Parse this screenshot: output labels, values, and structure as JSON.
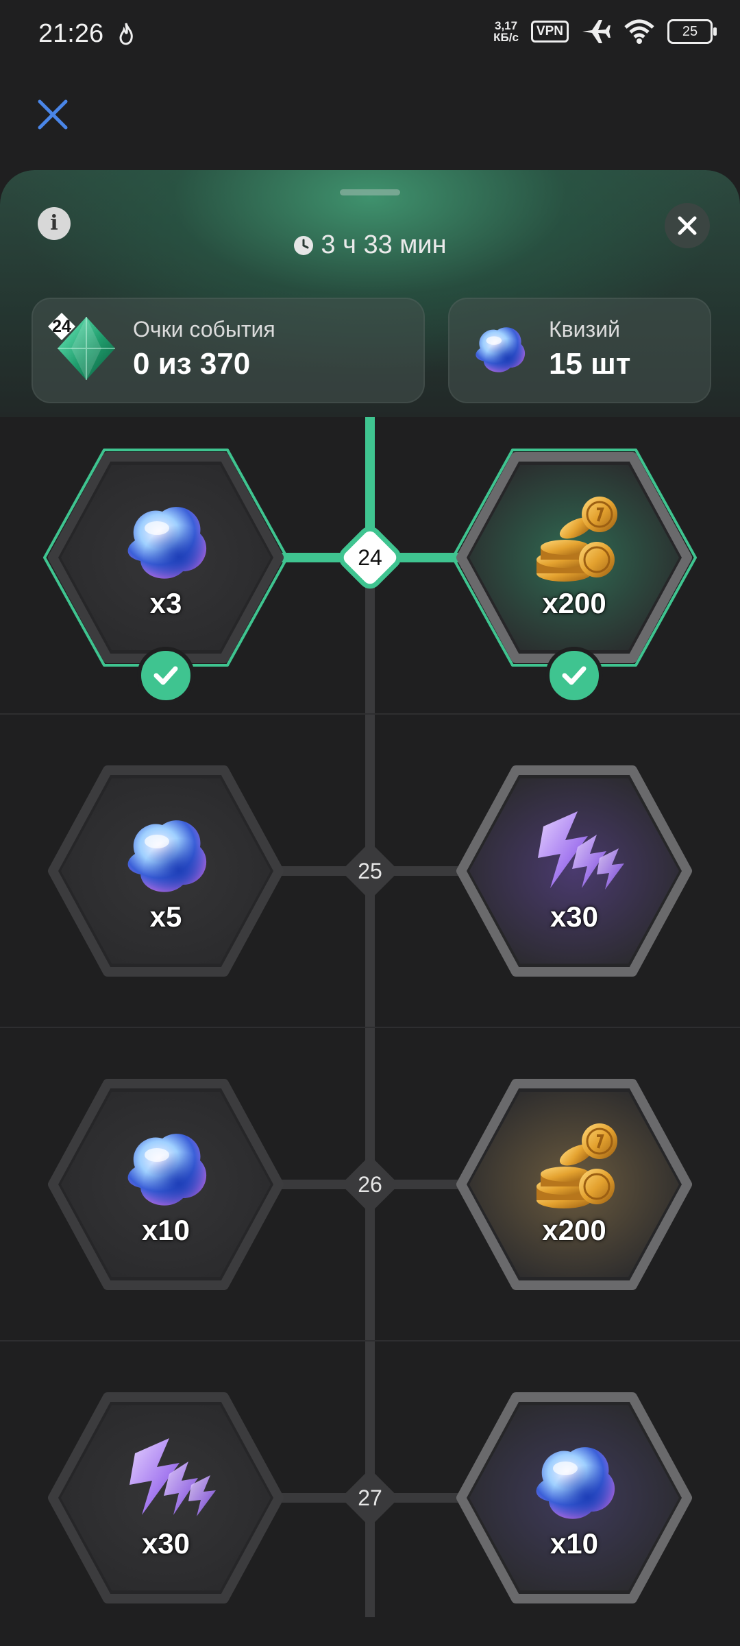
{
  "status_bar": {
    "time": "21:26",
    "net_speed_value": "3,17",
    "net_speed_unit": "КБ/с",
    "vpn": "VPN",
    "battery": "25"
  },
  "sheet": {
    "timer": "3 ч 33 мин",
    "info_glyph": "i",
    "event_points": {
      "label": "Очки события",
      "value": "0 из 370",
      "level": "24"
    },
    "quartz": {
      "label": "Квизий",
      "value": "15 шт"
    }
  },
  "track": {
    "rows": [
      {
        "level": "24",
        "active": true,
        "left": {
          "icon": "quartz-icon",
          "amount": "x3",
          "claimed": true
        },
        "right": {
          "icon": "coins-icon",
          "amount": "x200",
          "claimed": true
        }
      },
      {
        "level": "25",
        "active": false,
        "left": {
          "icon": "quartz-icon",
          "amount": "x5",
          "claimed": false
        },
        "right": {
          "icon": "energy-icon",
          "amount": "x30",
          "claimed": false
        }
      },
      {
        "level": "26",
        "active": false,
        "left": {
          "icon": "quartz-icon",
          "amount": "x10",
          "claimed": false
        },
        "right": {
          "icon": "coins-icon",
          "amount": "x200",
          "claimed": false
        }
      },
      {
        "level": "27",
        "active": false,
        "left": {
          "icon": "energy-icon",
          "amount": "x30",
          "claimed": false
        },
        "right": {
          "icon": "quartz-icon",
          "amount": "x10",
          "claimed": false
        }
      }
    ]
  },
  "colors": {
    "accent": "#3fc490",
    "background": "#1f1f20",
    "close_blue": "#4a86e8"
  }
}
